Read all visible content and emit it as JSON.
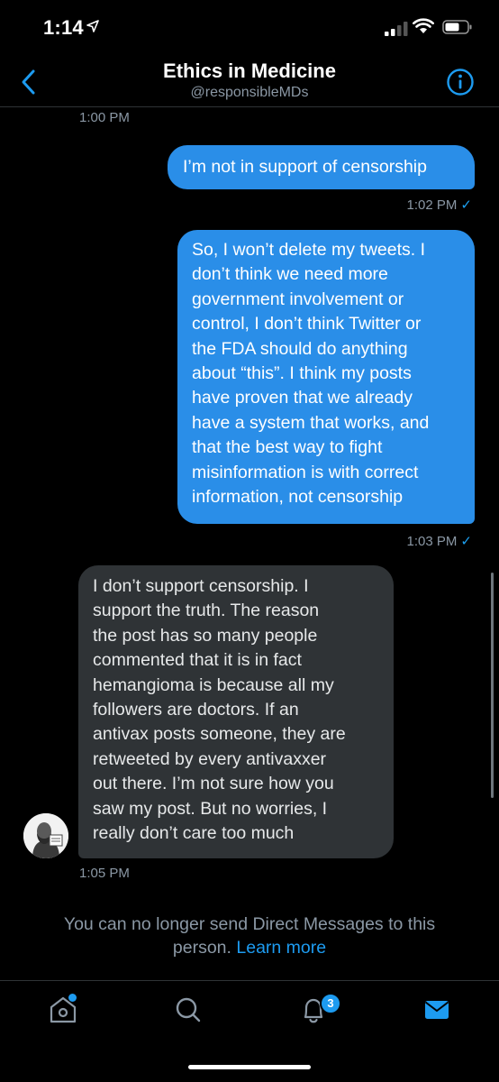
{
  "status_bar": {
    "time": "1:14"
  },
  "header": {
    "title": "Ethics in Medicine",
    "handle": "@responsibleMDs"
  },
  "messages": [
    {
      "timestamp": "1:00 PM"
    },
    {
      "direction": "outgoing",
      "lines": [
        "I’m not in support of censorship"
      ],
      "timestamp": "1:02 PM",
      "read_check": "✓"
    },
    {
      "direction": "outgoing",
      "lines": [
        "So, I won’t delete my tweets. I",
        "don’t think we need more",
        "government involvement or",
        "control, I don’t think Twitter or",
        "the FDA should do anything",
        "about “this”. I think my posts",
        "have proven that we already",
        "have a system that works, and",
        "that the best way to fight",
        "misinformation is with correct",
        "information, not censorship"
      ],
      "timestamp": "1:03 PM",
      "read_check": "✓"
    },
    {
      "direction": "incoming",
      "lines": [
        "I don’t support censorship. I",
        "support the truth. The reason",
        "the post has so many people",
        "commented that it is in fact",
        "hemangioma is because all my",
        "followers are doctors. If an",
        "antivax posts someone, they are",
        "retweeted by every antivaxxer",
        "out there. I’m not sure how you",
        "saw my post. But no worries, I",
        "really don’t care too much"
      ],
      "timestamp": "1:05 PM"
    }
  ],
  "notice": {
    "line1": "You can no longer send Direct Messages to this",
    "line2": "person.",
    "learn_more": "Learn more"
  },
  "tab_bar": {
    "tabs": [
      {
        "name": "home-icon",
        "active": false
      },
      {
        "name": "search-icon",
        "active": false
      },
      {
        "name": "notifications-icon",
        "active": false
      },
      {
        "name": "messages-icon",
        "active": true
      }
    ],
    "notifications_badge": "3"
  },
  "colors": {
    "accent": "#1d9bf0",
    "outgoing_bubble": "#2a8ee8",
    "incoming_bubble": "#2f3336",
    "secondary_text": "#8b98a5"
  }
}
